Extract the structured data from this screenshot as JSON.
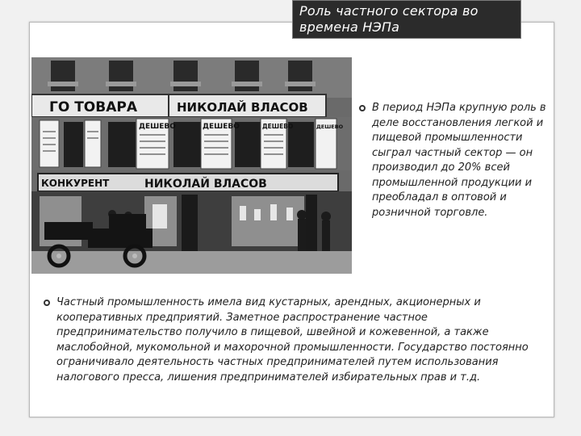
{
  "slide": {
    "title": "Роль частного сектора во времена НЭПа",
    "bullets": [
      "В период НЭПа крупную роль в деле восстановления легкой и пищевой промышленности сыграл частный сектор — он производил до 20% всей промышленной продукции и преобладал в оптовой и розничной торговле.",
      "Частный промышленность имела вид кустарных, арендных, акционерных и кооперативных предприятий. Заметное распространение частное предпринимательство получило в пищевой, швейной и кожевенной, а также маслобойной, мукомольной и махорочной промышленности. Государство постоянно ограничивало деятельность частных предпринимателей путем использования налогового пресса, лишения предпринимателей избирательных прав и т.д."
    ],
    "photo": {
      "signs": {
        "top_left": "ГО ТОВАРА",
        "top_right": "НИКОЛАЙ ВЛАСОВ",
        "cheap_1": "ДЕШЕВО",
        "cheap_2": "ДЕШЕВО",
        "cheap_3": "ДЕШЕВО",
        "cheap_4": "ДЕШЕВО",
        "competitor": "КОНКУРЕНТ",
        "lower_name": "НИКОЛАЙ ВЛАСОВ"
      }
    }
  },
  "colors": {
    "title_bg": "#2b2b2b",
    "slide_bg": "#ffffff",
    "page_bg": "#f1f1f1"
  }
}
